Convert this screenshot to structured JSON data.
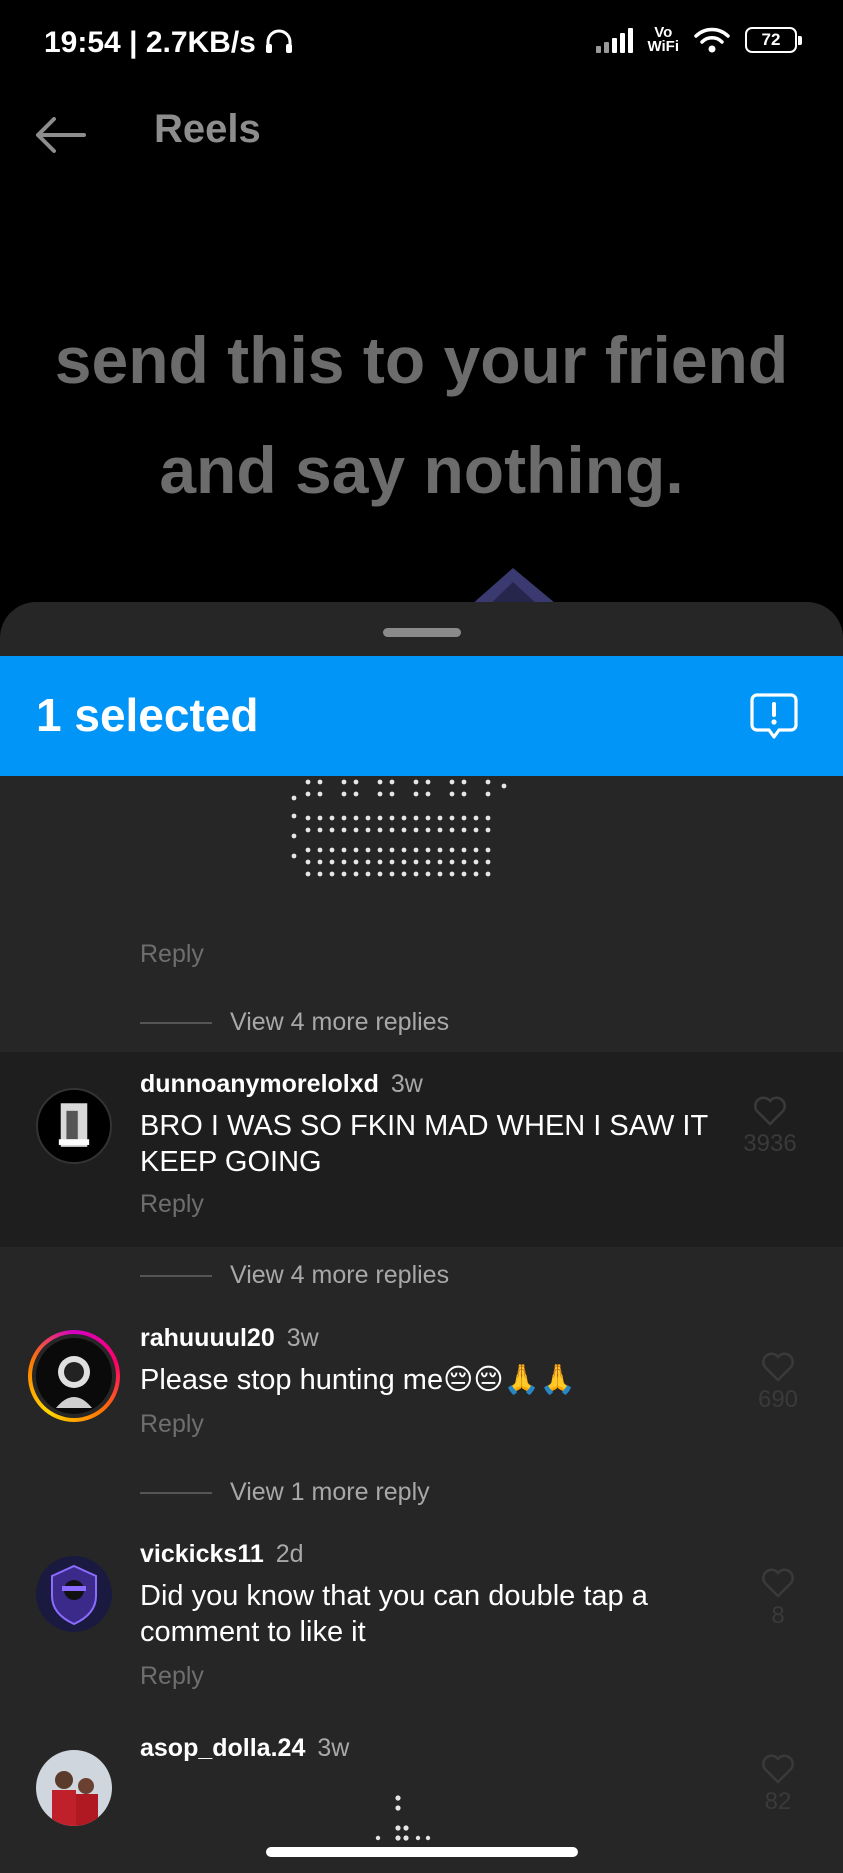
{
  "status_bar": {
    "time": "19:54",
    "network_speed": "2.7KB/s",
    "vowifi_top": "Vo",
    "vowifi_bottom": "WiFi",
    "battery": "72"
  },
  "top_bar": {
    "title": "Reels"
  },
  "reel": {
    "line1": "send this to your friend",
    "line2": "and say nothing."
  },
  "selection_bar": {
    "label": "1 selected",
    "accent": "#0095f6"
  },
  "thread_top": {
    "reply_label": "Reply",
    "view_more": "View 4 more replies"
  },
  "comments": [
    {
      "username": "dunnoanymorelolxd",
      "age": "3w",
      "text": "BRO I WAS SO FKIN MAD WHEN I SAW IT KEEP GOING",
      "reply": "Reply",
      "likes": "3936",
      "view_more": "View 4 more replies"
    },
    {
      "username": "rahuuuul20",
      "age": "3w",
      "text": "Please stop hunting me😔😔🙏🙏",
      "reply": "Reply",
      "likes": "690",
      "view_more": "View 1 more reply"
    },
    {
      "username": "vickicks11",
      "age": "2d",
      "text": "Did you know that you can double tap a comment to like it",
      "reply": "Reply",
      "likes": "8"
    },
    {
      "username": "asop_dolla.24",
      "age": "3w",
      "text": "",
      "likes": "82"
    }
  ],
  "icons": {
    "back": "arrow-left-icon",
    "report": "report-bubble-icon",
    "like": "heart-outline-icon",
    "headphones": "headphones-icon",
    "wifi": "wifi-icon"
  }
}
